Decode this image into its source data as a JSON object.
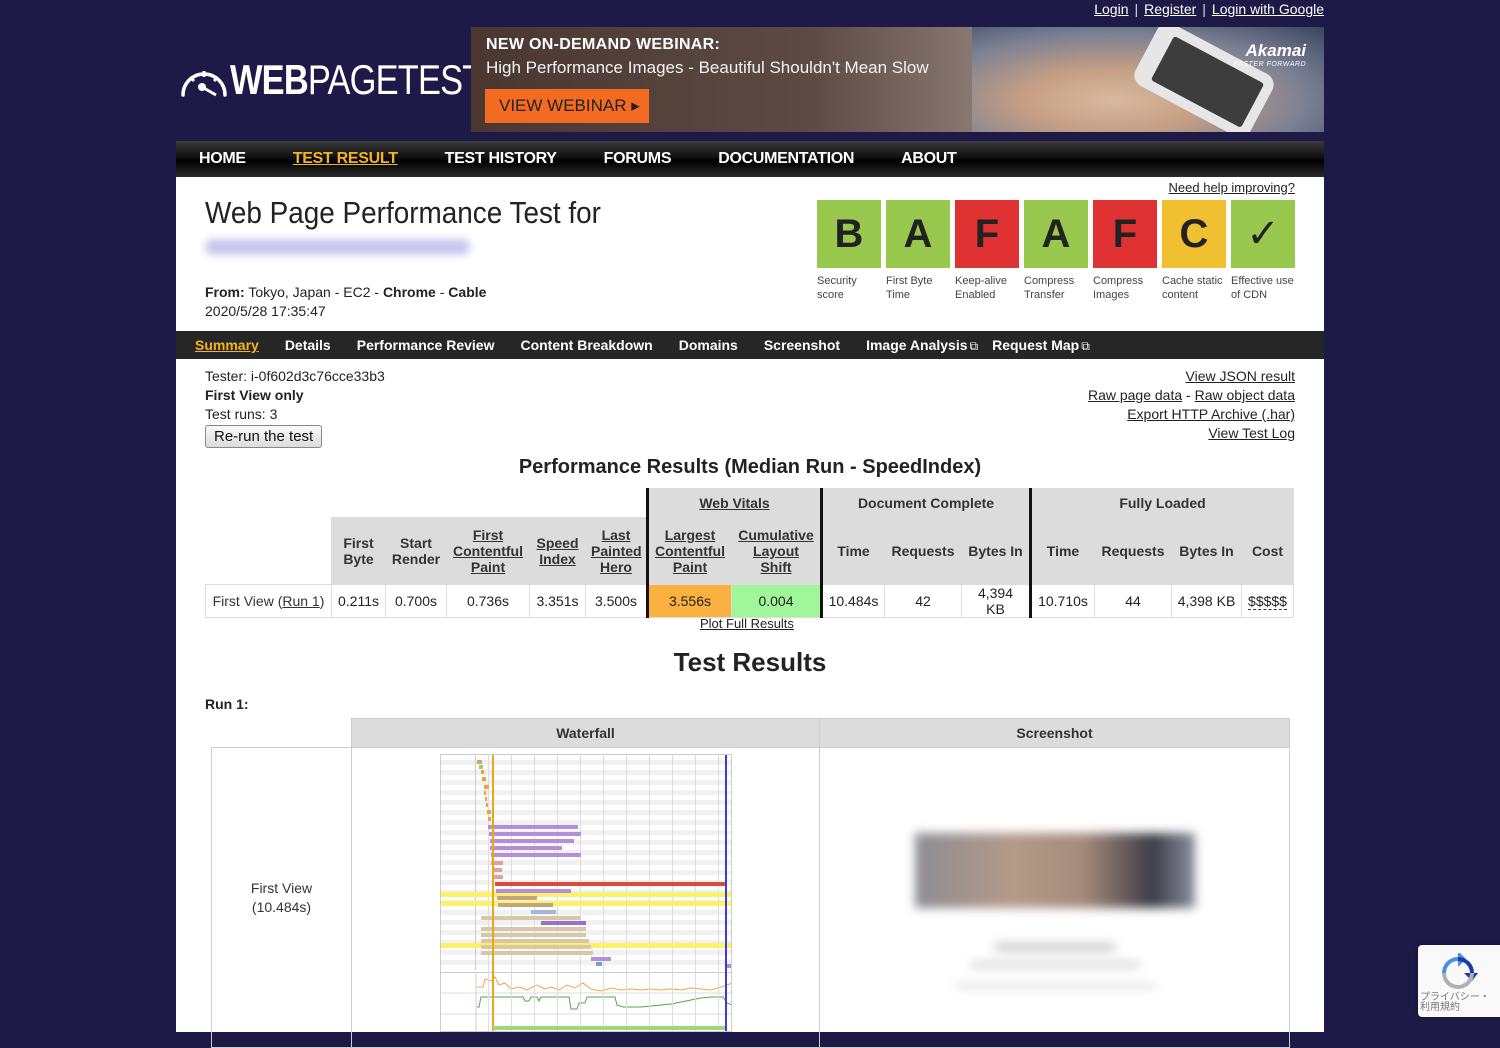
{
  "top_links": {
    "login": "Login",
    "separator": "|",
    "register": "Register",
    "login_google": "Login with Google"
  },
  "logo": {
    "bold": "WEB",
    "rest": "PAGETEST"
  },
  "banner": {
    "headline": "NEW ON-DEMAND WEBINAR:",
    "subline": "High Performance Images  -  Beautiful Shouldn't Mean Slow",
    "cta": "VIEW WEBINAR ▸",
    "sponsor": "Akamai",
    "sponsor_tag": "FASTER FORWARD"
  },
  "nav": {
    "items": [
      {
        "label": "HOME",
        "active": false
      },
      {
        "label": "TEST RESULT",
        "active": true
      },
      {
        "label": "TEST HISTORY",
        "active": false
      },
      {
        "label": "FORUMS",
        "active": false
      },
      {
        "label": "DOCUMENTATION",
        "active": false
      },
      {
        "label": "ABOUT",
        "active": false
      }
    ]
  },
  "header": {
    "title": "Web Page Performance Test for",
    "from_label": "From:",
    "from_value": "Tokyo, Japan - EC2 - ",
    "browser": "Chrome",
    "connection": "Cable",
    "timestamp": "2020/5/28 17:35:47",
    "help_link": "Need help improving?"
  },
  "grades": [
    {
      "grade": "B",
      "label": "Security score",
      "color": "#98c94e"
    },
    {
      "grade": "A",
      "label": "First Byte Time",
      "color": "#98c94e"
    },
    {
      "grade": "F",
      "label": "Keep-alive Enabled",
      "color": "#e03232"
    },
    {
      "grade": "A",
      "label": "Compress Transfer",
      "color": "#98c94e"
    },
    {
      "grade": "F",
      "label": "Compress Images",
      "color": "#e03232"
    },
    {
      "grade": "C",
      "label": "Cache static content",
      "color": "#f0c030"
    },
    {
      "grade": "✓",
      "label": "Effective use of CDN",
      "color": "#98c94e"
    }
  ],
  "subnav": {
    "items": [
      {
        "label": "Summary",
        "active": true,
        "external": false
      },
      {
        "label": "Details",
        "active": false,
        "external": false
      },
      {
        "label": "Performance Review",
        "active": false,
        "external": false
      },
      {
        "label": "Content Breakdown",
        "active": false,
        "external": false
      },
      {
        "label": "Domains",
        "active": false,
        "external": false
      },
      {
        "label": "Screenshot",
        "active": false,
        "external": false
      },
      {
        "label": "Image Analysis",
        "active": false,
        "external": true
      },
      {
        "label": "Request Map",
        "active": false,
        "external": true
      }
    ]
  },
  "test_info": {
    "tester": "Tester: i-0f602d3c76cce33b3",
    "view": "First View only",
    "runs": "Test runs: 3",
    "rerun_button": "Re-run the test"
  },
  "result_links": {
    "json": "View JSON result",
    "raw_page": "Raw page data",
    "dash": " - ",
    "raw_object": "Raw object data",
    "har": "Export HTTP Archive (.har)",
    "log": "View Test Log"
  },
  "performance": {
    "title": "Performance Results (Median Run - SpeedIndex)",
    "groups": {
      "web_vitals": "Web Vitals",
      "document_complete": "Document Complete",
      "fully_loaded": "Fully Loaded"
    },
    "columns": {
      "first_byte": "First Byte",
      "start_render": "Start Render",
      "fcp": "First Contentful Paint",
      "speed_index": "Speed Index",
      "lph": "Last Painted Hero",
      "lcp": "Largest Contentful Paint",
      "cls": "Cumulative Layout Shift",
      "dc_time": "Time",
      "dc_requests": "Requests",
      "dc_bytes": "Bytes In",
      "fl_time": "Time",
      "fl_requests": "Requests",
      "fl_bytes": "Bytes In",
      "cost": "Cost"
    },
    "row": {
      "label": "First View (",
      "run_link": "Run 1",
      "label_end": ")",
      "first_byte": "0.211s",
      "start_render": "0.700s",
      "fcp": "0.736s",
      "speed_index": "3.351s",
      "lph": "3.500s",
      "lcp": "3.556s",
      "cls": "0.004",
      "dc_time": "10.484s",
      "dc_requests": "42",
      "dc_bytes": "4,394 KB",
      "fl_time": "10.710s",
      "fl_requests": "44",
      "fl_bytes": "4,398 KB",
      "cost": "$$$$$"
    },
    "colors": {
      "lcp": "#fbb040",
      "cls": "#a0f79a"
    },
    "plot_link": "Plot Full Results"
  },
  "test_results": {
    "title": "Test Results",
    "run_label": "Run 1:",
    "columns": {
      "waterfall": "Waterfall",
      "screenshot": "Screenshot"
    },
    "first_view_label": "First View",
    "first_view_time": "(10.484s)"
  },
  "recaptcha": {
    "line1": "プライバシー・",
    "line2": "利用規約"
  }
}
